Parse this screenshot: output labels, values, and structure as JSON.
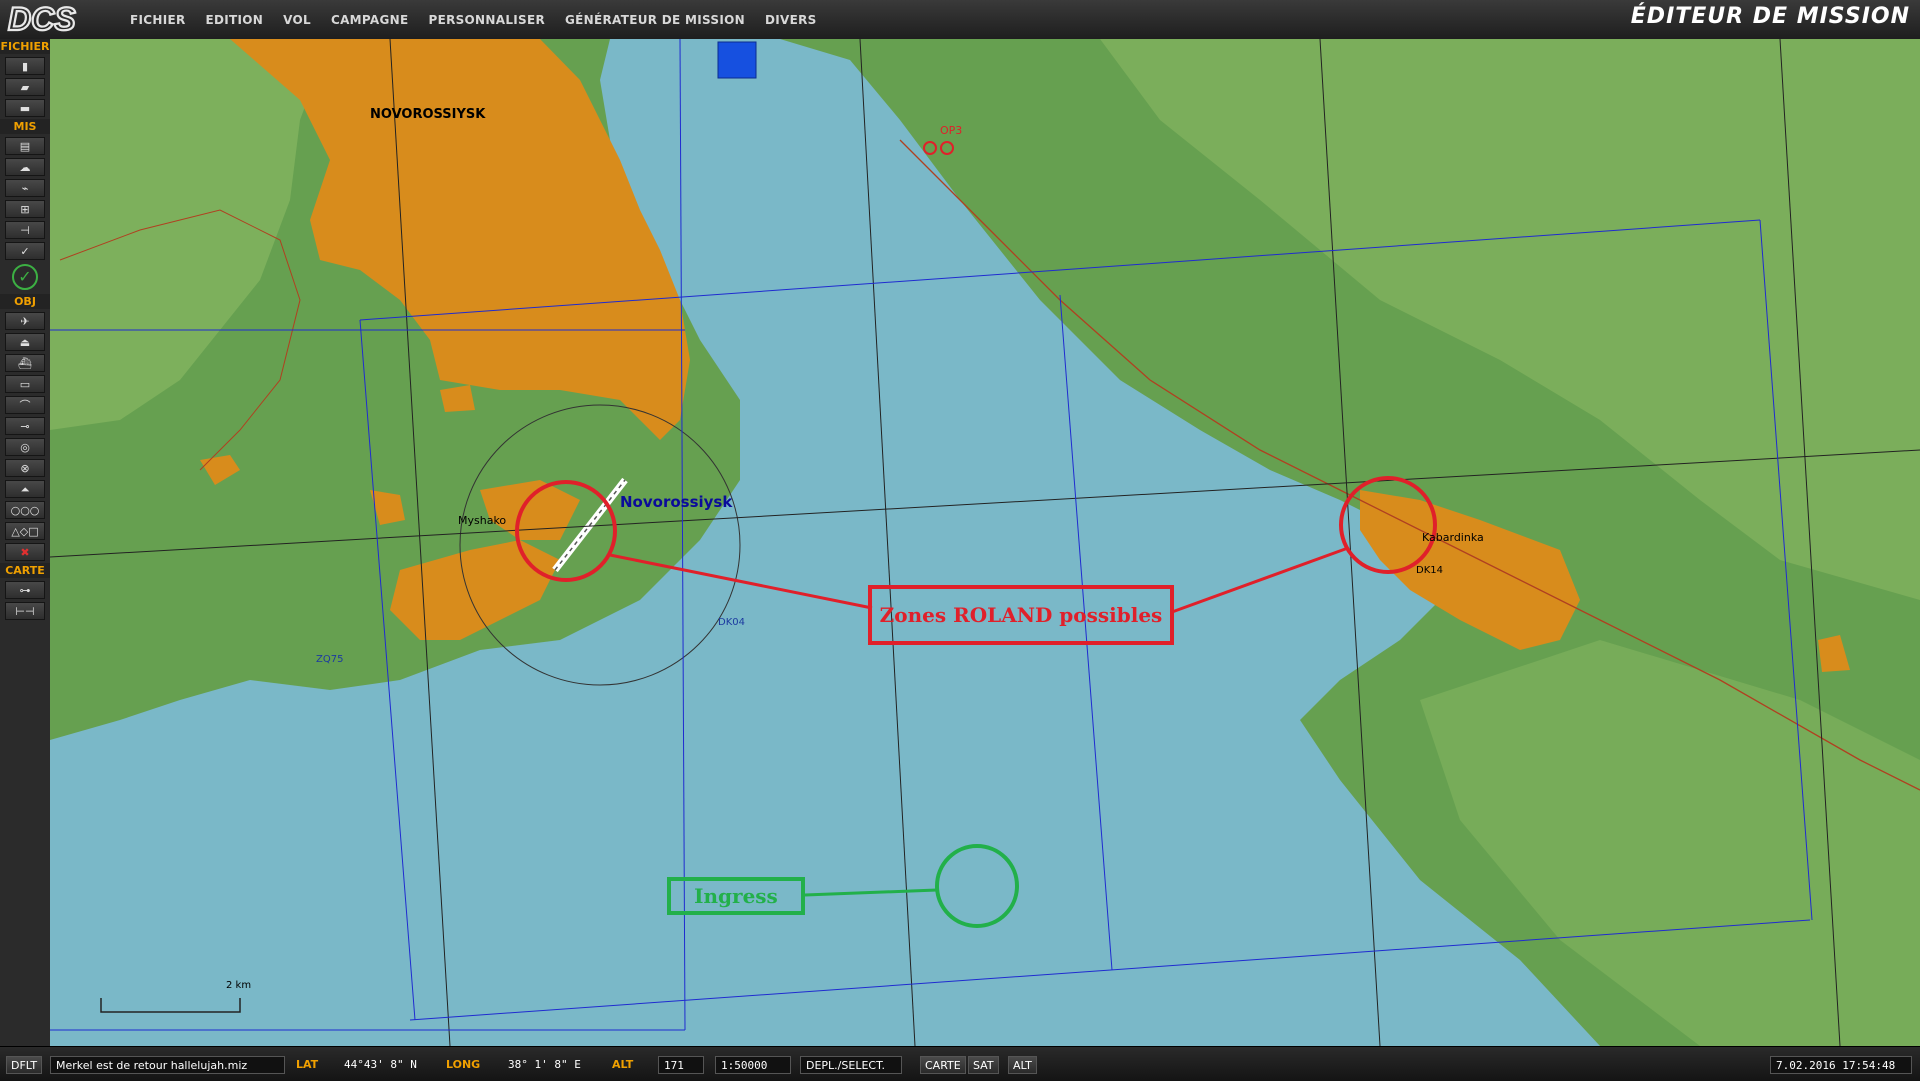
{
  "app": {
    "logo": "DCS",
    "title": "ÉDITEUR DE MISSION"
  },
  "menu": [
    "FICHIER",
    "EDITION",
    "VOL",
    "CAMPAGNE",
    "PERSONNALISER",
    "GÉNÉRATEUR DE MISSION",
    "DIVERS"
  ],
  "toolbar": {
    "sections": {
      "fichier": "FICHIER",
      "mis": "MIS",
      "obj": "OBJ",
      "carte": "CARTE"
    },
    "fichier_icons": [
      "new-file-icon",
      "open-folder-icon",
      "save-icon"
    ],
    "mis_icons": [
      "briefing-icon",
      "weather-icon",
      "triggers-icon",
      "resource-manager-icon",
      "goals-icon",
      "check-icon"
    ],
    "obj_icons": [
      "plane-icon",
      "helicopter-icon",
      "ship-icon",
      "vehicle-icon",
      "armor-group-icon",
      "static-icon",
      "zone-icon",
      "target-icon",
      "airport-icon",
      "template-icon",
      "shapes-icon",
      "delete-icon"
    ],
    "carte_icons": [
      "key-icon",
      "ruler-icon"
    ]
  },
  "map": {
    "labels": {
      "novorossiysk_city": "NOVOROSSIYSK",
      "novorossiysk_airfield": "Novorossiysk",
      "myshako": "Myshako",
      "kabardinka": "Kabardinka",
      "dk14": "DK14",
      "dk04": "DK04",
      "zq75": "ZQ75",
      "op3": "OP3"
    },
    "annotations": {
      "roland": "Zones ROLAND possibles",
      "ingress": "Ingress"
    },
    "scale_label": "2 km",
    "colors": {
      "sea": "#7ab8c8",
      "land": "#66a050",
      "land_light": "#8cba64",
      "urban": "#d88c1c",
      "grid_blue": "#1f2bd0",
      "annotation_red": "#e0202a",
      "annotation_green": "#22b04a"
    }
  },
  "status": {
    "dflt": "DFLT",
    "mission_file": "Merkel est de retour hallelujah.miz",
    "lat_label": "LAT",
    "lat_value": "44°43' 8\" N",
    "long_label": "LONG",
    "long_value": "38° 1' 8\" E",
    "alt_label": "ALT",
    "alt_value": "171",
    "scale": "1:50000",
    "mode": "DEPL./SELECT.",
    "carte_btn": "CARTE",
    "sat_btn": "SAT",
    "alt_btn": "ALT",
    "datetime": "7.02.2016 17:54:48"
  }
}
